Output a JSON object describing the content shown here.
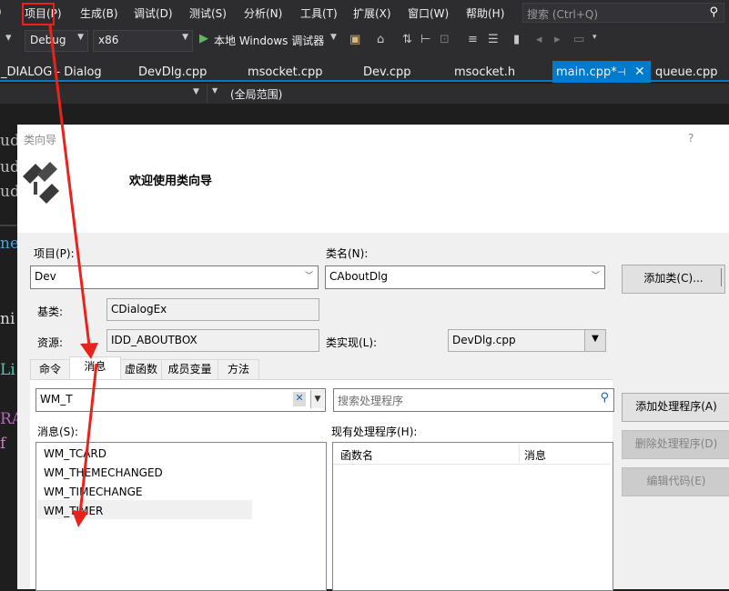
{
  "menu": {
    "items": [
      "项目(P)",
      "生成(B)",
      "调试(D)",
      "测试(S)",
      "分析(N)",
      "工具(T)",
      "扩展(X)",
      "窗口(W)",
      "帮助(H)"
    ],
    "search_placeholder": "搜索 (Ctrl+Q)"
  },
  "toolbar": {
    "config": "Debug",
    "platform": "x86",
    "run_label": "本地 Windows 调试器"
  },
  "tabs": [
    "_DIALOG - Dialog",
    "DevDlg.cpp",
    "msocket.cpp",
    "Dev.cpp",
    "msocket.h",
    "main.cpp*",
    "queue.cpp"
  ],
  "active_tab": "main.cpp*",
  "scope": "(全局范围)",
  "editor_fragments": [
    "ud",
    "ud",
    "ud",
    "ne",
    "ni",
    "Li",
    "RA",
    "f"
  ],
  "dialog": {
    "title": "类向导",
    "help": "?",
    "welcome": "欢迎使用类向导",
    "project_label": "项目(P):",
    "project_value": "Dev",
    "classname_label": "类名(N):",
    "classname_value": "CAboutDlg",
    "add_class_button": "添加类(C)...",
    "base_label": "基类:",
    "base_value": "CDialogEx",
    "resource_label": "资源:",
    "resource_value": "IDD_ABOUTBOX",
    "impl_label": "类实现(L):",
    "impl_value": "DevDlg.cpp",
    "tabs": [
      "命令",
      "消息",
      "虚函数",
      "成员变量",
      "方法"
    ],
    "active_tab": "消息",
    "filter_value": "WM_T",
    "handler_search_placeholder": "搜索处理程序",
    "messages_label": "消息(S):",
    "messages": [
      "WM_TCARD",
      "WM_THEMECHANGED",
      "WM_TIMECHANGE",
      "WM_TIMER"
    ],
    "selected_message": "WM_TIMER",
    "existing_label": "现有处理程序(H):",
    "col_function": "函数名",
    "col_message": "消息",
    "add_handler_button": "添加处理程序(A)",
    "delete_handler_button": "删除处理程序(D)",
    "edit_code_button": "编辑代码(E)"
  },
  "annotation_color": "#e8231c"
}
